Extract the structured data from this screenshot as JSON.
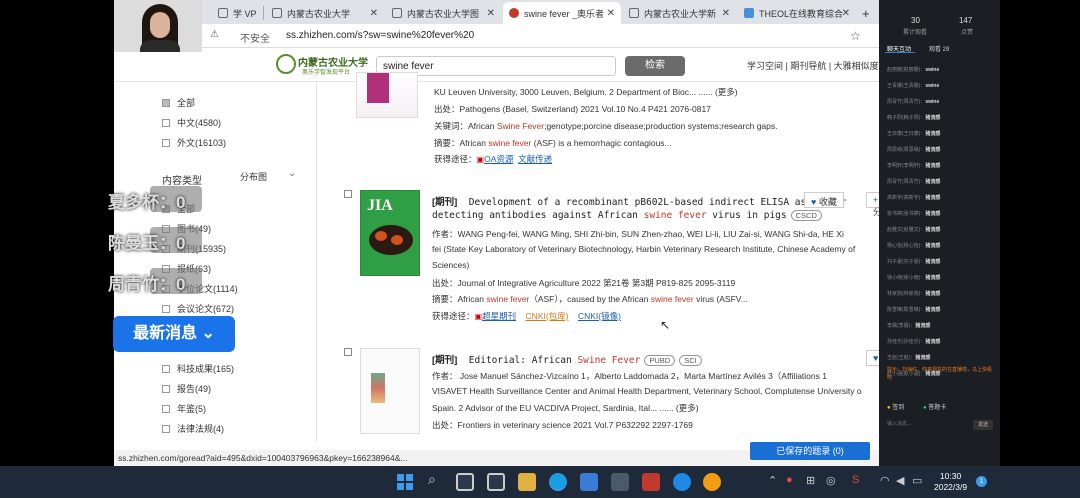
{
  "browser": {
    "tabs": [
      {
        "label": "学 VP",
        "icon": "page-icon"
      },
      {
        "label": "内蒙古农业大学",
        "icon": "page-icon"
      },
      {
        "label": "内蒙古农业大学图",
        "icon": "page-icon"
      },
      {
        "label": "swine fever _奥乐者",
        "icon": "zhizhen-icon"
      },
      {
        "label": "内蒙古农业大学新",
        "icon": "page-icon"
      },
      {
        "label": "THEOL在线教育综合",
        "icon": "theol-icon"
      }
    ],
    "new_tab": "+",
    "insecure_label": "不安全",
    "url": "ss.zhizhen.com/s?sw=swine%20fever%20",
    "status_url": "ss.zhizhen.com/goread?aid=495&dxid=100403796963&pkey=166238964&..."
  },
  "site": {
    "logo_title": "内蒙古农业大学",
    "logo_subtitle": "奥乐学智发现平台",
    "search_value": "swine fever",
    "search_button": "检索",
    "header_links": "学习空间 | 期刊导航 | 大雅相似度"
  },
  "sidebar": {
    "lang_items": [
      {
        "label": "全部",
        "checked": true
      },
      {
        "label": "中文(4580)",
        "checked": false
      },
      {
        "label": "外文(16103)",
        "checked": false
      }
    ],
    "type_title": "内容类型",
    "distribution_label": "分布图",
    "type_items": [
      {
        "label": "全部",
        "checked": true
      },
      {
        "label": "图书(49)",
        "checked": false
      },
      {
        "label": "期刊(15935)",
        "checked": false
      },
      {
        "label": "报纸(63)",
        "checked": false
      },
      {
        "label": "学位论文(1114)",
        "checked": false
      },
      {
        "label": "会议论文(672)",
        "checked": false
      },
      {
        "label": "专利",
        "checked": false
      },
      {
        "label": "科技成果(165)",
        "checked": false
      },
      {
        "label": "报告(49)",
        "checked": false
      },
      {
        "label": "年鉴(5)",
        "checked": false
      },
      {
        "label": "法律法规(4)",
        "checked": false
      }
    ]
  },
  "results": [
    {
      "lines": [
        "KU Leuven University, 3000 Leuven, Belgium. 2 Department of Bioc... ......  (更多)",
        "出处：Pathogens (Basel, Switzerland) 2021 Vol.10 No.4 P421  2076-0817"
      ],
      "keywords_prefix": "关键词：African ",
      "keywords_hl": "Swine Fever",
      "keywords_rest": ";genotype;porcine disease;production systems;research gaps.",
      "abstract_prefix": "摘要：African ",
      "abstract_hl": "swine fever",
      "abstract_rest": " (ASF) is a hemorrhagic contagious...",
      "access_label": "获得途径：",
      "access_links": [
        "OA资源",
        "文献传递"
      ]
    },
    {
      "tag": "[期刊]",
      "title_line1": "Development of a recombinant pB602L-based indirect ELISA assay for",
      "title_line2_prefix": "detecting antibodies against African ",
      "title_line2_hl": "swine fever",
      "title_line2_rest": " virus in pigs",
      "badge": "CSCD",
      "authors_line1": "作者：WANG Peng-fei, WANG Ming, SHI Zhi-bin, SUN Zhen-zhao, WEI Li-li, LIU Zai-si, WANG Shi-da, HE Xi",
      "authors_line2": "fei (State Key Laboratory of Veterinary Biotechnology, Harbin Veterinary Research Institute, Chinese Academy of",
      "authors_line3": "Sciences)",
      "source": "出处：Journal of Integrative Agriculture 2022 第21卷 第3期 P819-825  2095-3119",
      "abstract_prefix": "摘要：African ",
      "abstract_hl1": "swine fever",
      "abstract_mid": "（ASF），caused by the African ",
      "abstract_hl2": "swine fever",
      "abstract_rest": " virus  (ASFV...",
      "access_label": "获得途径：",
      "access_links": [
        "超星期刊",
        "CNKI(包库)",
        "CNKI(镜像)"
      ],
      "favorite_label": "收藏",
      "share_label": "分",
      "cover_text": "JIA"
    },
    {
      "tag": "[期刊]",
      "title_prefix": "Editorial: African ",
      "title_hl": "Swine Fever",
      "badges": [
        "PUBD",
        "SCI"
      ],
      "authors_line1": "作者：  Jose Manuel Sánchez-Vizcaíno   1，Alberto Laddomada   2，Marta Martínez Avilés   3（Affiliations 1",
      "authors_line2": "VISAVET Health Surveillance Center and Animal Health Department, Veterinary School, Complutense University o",
      "authors_line3": "Spain. 2 Advisor of the EU VACDIVA Project, Sardinia, Ital... ......  (更多)",
      "source": "出处：Frontiers in veterinary science 2021 Vol.7 P632292  2297-1769"
    }
  ],
  "saved_button": "已保存的题录  (0)",
  "overlay": {
    "danmu": [
      "夏多杯：0",
      "陈曼玉：0",
      "周青竹：0"
    ],
    "news_button": "最新消息 ⌄"
  },
  "panel": {
    "stats": [
      {
        "num": "30",
        "label": "累计观看"
      },
      {
        "num": "147",
        "label": "点赞"
      }
    ],
    "tabs": [
      "聊天互动",
      "观看 29"
    ],
    "chats": [
      {
        "name": "赵丽媛(赵丽媛)",
        "msg": "swine"
      },
      {
        "name": "王青娜(王青娜)",
        "msg": "swine"
      },
      {
        "name": "周青竹(周青竹)",
        "msg": "swine"
      },
      {
        "name": "韩子阳(韩子阳)",
        "msg": "猪流感"
      },
      {
        "name": "王日康(王日康)",
        "msg": "猪流感"
      },
      {
        "name": "周思缘(周思缘)",
        "msg": "猪流感"
      },
      {
        "name": "李明轩(李明轩)",
        "msg": "猪流感"
      },
      {
        "name": "周青竹(周青竹)",
        "msg": "猪流感"
      },
      {
        "name": "高新宇(高新宇)",
        "msg": "猪流感"
      },
      {
        "name": "张书婷(张书婷)",
        "msg": "猪流感"
      },
      {
        "name": "赵雅文(赵雅文)",
        "msg": "猪流感"
      },
      {
        "name": "杨心怡(杨心怡)",
        "msg": "猪流感"
      },
      {
        "name": "刘子豪(刘子豪)",
        "msg": "猪流感"
      },
      {
        "name": "徐小雨(徐小雨)",
        "msg": "猪流感"
      },
      {
        "name": "林家驹(林家驹)",
        "msg": "猪流感"
      },
      {
        "name": "陈雪琳(陈雪琳)",
        "msg": "猪流感"
      },
      {
        "name": "李晨(李晨)",
        "msg": "猪流感"
      },
      {
        "name": "孙佳乐(孙佳乐)",
        "msg": "猪流感"
      },
      {
        "name": "王赵(王赵)",
        "msg": "猪流感"
      },
      {
        "name": "赵小涵(赵小涵)",
        "msg": "猪流感"
      }
    ],
    "notice": "提示：刘海红，你来现在的在直播啦，马上快看吧",
    "actions": [
      "签到",
      "答题卡"
    ],
    "input_placeholder": "输入消息...",
    "send": "发送"
  },
  "taskbar": {
    "time": "10:30",
    "date": "2022/3/9",
    "notify_count": "1"
  }
}
